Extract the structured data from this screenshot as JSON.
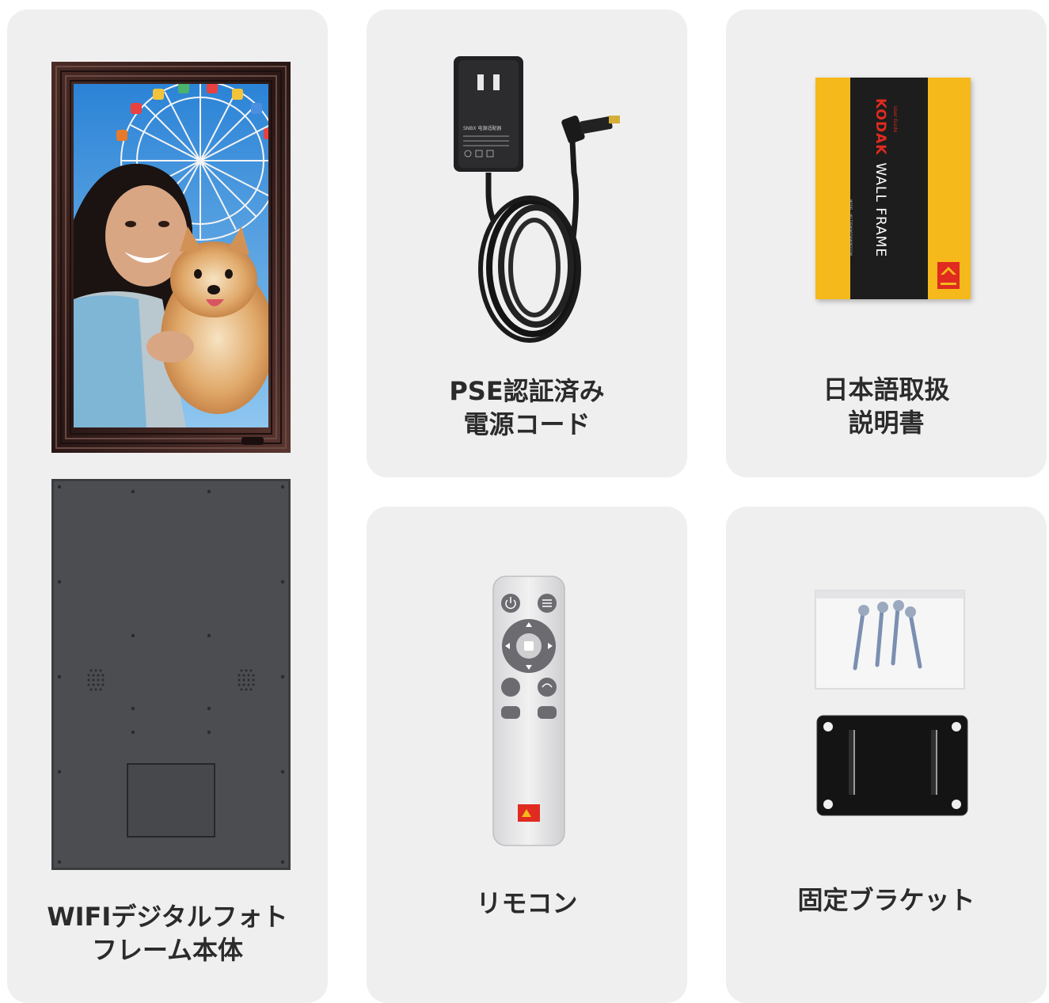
{
  "items": [
    {
      "id": "frame",
      "lines": [
        "WIFIデジタルフォト",
        "フレーム本体"
      ]
    },
    {
      "id": "power-cord",
      "lines": [
        "PSE認証済み",
        "電源コード"
      ]
    },
    {
      "id": "manual",
      "lines": [
        "日本語取扱",
        "説明書"
      ]
    },
    {
      "id": "remote",
      "lines": [
        "リモコン"
      ]
    },
    {
      "id": "bracket",
      "lines": [
        "固定ブラケット"
      ]
    }
  ],
  "manual_cover": {
    "brand": "KODAK",
    "subtitle": "User Guide",
    "title": "WALL FRAME",
    "model": "MODEL : W173SW/W156W/W32OW"
  },
  "adapter_text": "SNBX 电源适配器",
  "colors": {
    "card_bg": "#efefef",
    "kodak_yellow": "#f5b91b",
    "kodak_red": "#e02b20",
    "frame_wood": "#3a2320"
  }
}
